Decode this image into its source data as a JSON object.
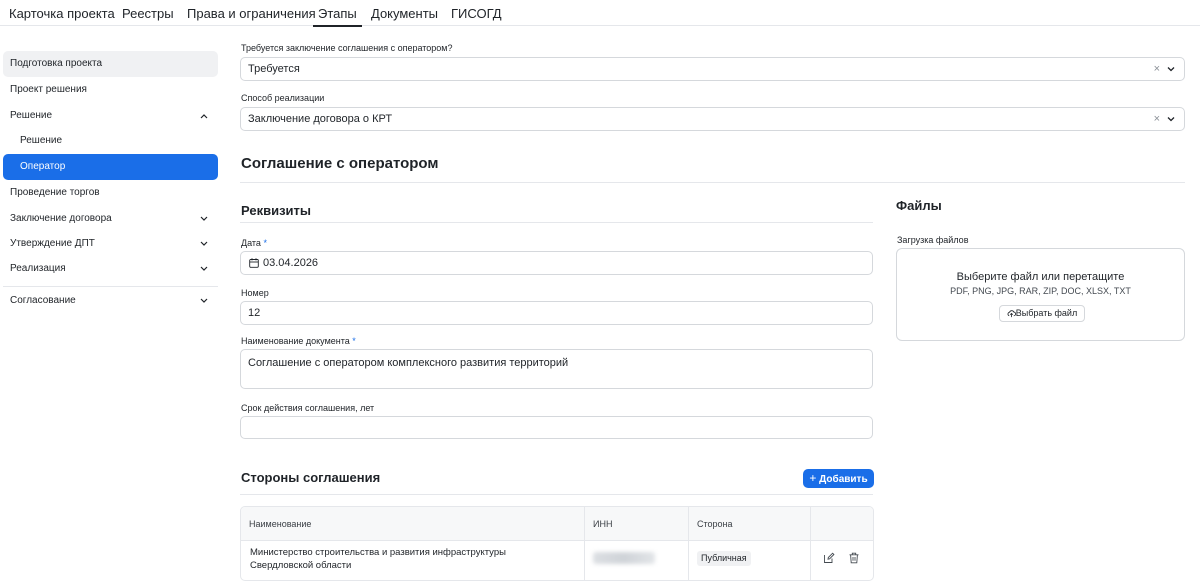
{
  "top_tabs": [
    {
      "label": "Карточка проекта"
    },
    {
      "label": "Реестры"
    },
    {
      "label": "Права и ограничения"
    },
    {
      "label": "Этапы"
    },
    {
      "label": "Документы"
    },
    {
      "label": "ГИСОГД"
    }
  ],
  "active_tab": "Этапы",
  "sidebar": {
    "items": [
      {
        "label": "Подготовка проекта"
      },
      {
        "label": "Проект решения"
      },
      {
        "label": "Решение"
      },
      {
        "label": "Решение"
      },
      {
        "label": "Оператор"
      },
      {
        "label": "Проведение торгов"
      },
      {
        "label": "Заключение договора"
      },
      {
        "label": "Утверждение ДПТ"
      },
      {
        "label": "Реализация"
      },
      {
        "label": "Согласование"
      }
    ],
    "active": "Оператор"
  },
  "form": {
    "q1_label": "Требуется заключение соглашения с оператором?",
    "q1_value": "Требуется",
    "q2_label": "Способ реализации",
    "q2_value": "Заключение договора о КРТ",
    "clear_glyph": "×"
  },
  "section_title": "Соглашение с оператором",
  "requisites": {
    "title": "Реквизиты",
    "date_label": "Дата",
    "date_value": "03.04.2026",
    "number_label": "Номер",
    "number_value": "12",
    "docname_label": "Наименование документа",
    "docname_value": "Соглашение с оператором комплексного развития территорий",
    "term_label": "Срок действия соглашения, лет",
    "term_value": "",
    "required_mark": "*"
  },
  "files": {
    "title": "Файлы",
    "upload_label": "Загрузка файлов",
    "upload_title": "Выберите файл или перетащите",
    "upload_types": "PDF, PNG, JPG, RAR, ZIP, DOC, XLSX, TXT",
    "upload_button": "Выбрать файл"
  },
  "parties": {
    "title": "Стороны соглашения",
    "add_button": "Добавить",
    "columns": [
      "Наименование",
      "ИНН",
      "Сторона"
    ],
    "rows": [
      {
        "name_line1": "Министерство строительства и развития инфраструктуры",
        "name_line2": "Свердловской области",
        "side": "Публичная"
      }
    ]
  },
  "colors": {
    "accent": "#1a6ee8",
    "border": "#d5d8dc",
    "muted_bg": "#f0f1f3"
  }
}
